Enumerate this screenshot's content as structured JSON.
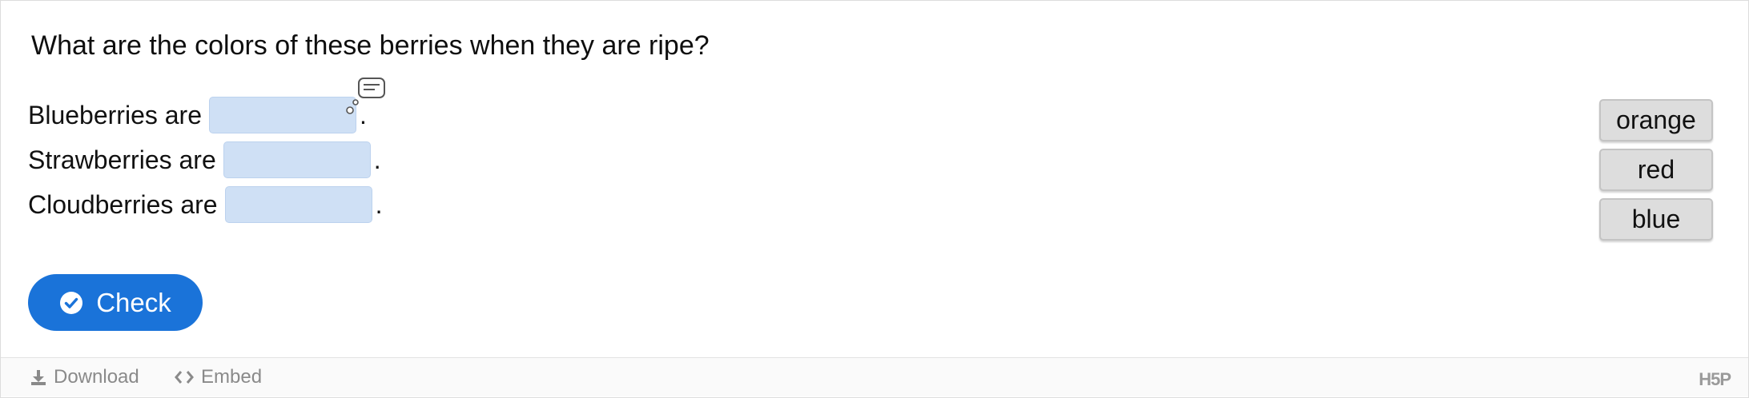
{
  "question": "What are the colors of these berries when they are ripe?",
  "sentences": [
    {
      "label": "Blueberries are",
      "suffix": ".",
      "has_tip": true
    },
    {
      "label": "Strawberries are",
      "suffix": "."
    },
    {
      "label": "Cloudberries are",
      "suffix": "."
    }
  ],
  "draggables": [
    "orange",
    "red",
    "blue"
  ],
  "check_button": {
    "label": "Check",
    "icon": "check-circle-icon"
  },
  "footer": {
    "download_label": "Download",
    "embed_label": "Embed",
    "logo": "H5P"
  },
  "colors": {
    "dropzone": "#cfe0f5",
    "accent": "#1a73d9",
    "draggable_bg": "#dddddd"
  }
}
